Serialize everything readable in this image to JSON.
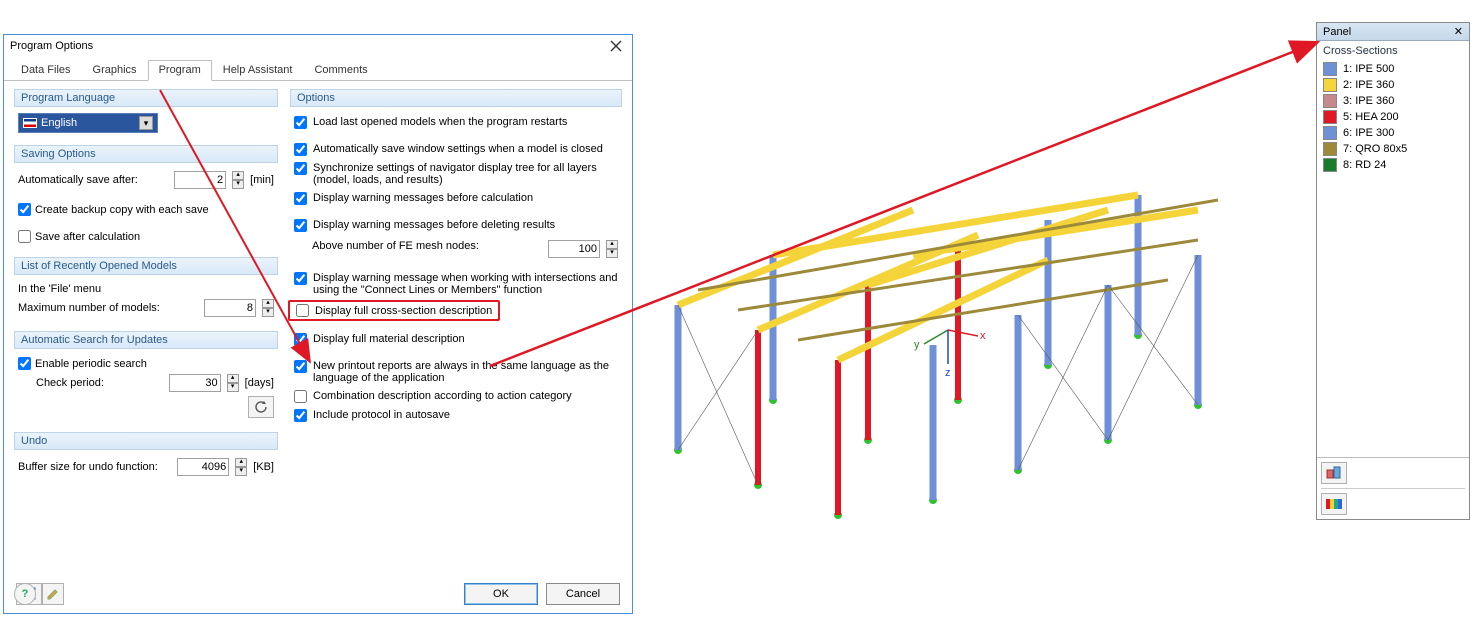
{
  "dialog": {
    "title": "Program Options",
    "tabs": [
      "Data Files",
      "Graphics",
      "Program",
      "Help Assistant",
      "Comments"
    ],
    "active_tab": 2,
    "groups": {
      "lang": {
        "header": "Program Language",
        "value": "English"
      },
      "saving": {
        "header": "Saving Options",
        "auto_save_label": "Automatically save after:",
        "auto_save_value": "2",
        "auto_save_unit": "[min]",
        "backup_label": "Create backup copy with each save",
        "backup_checked": true,
        "save_after_calc_label": "Save after calculation",
        "save_after_calc_checked": false
      },
      "recent": {
        "header": "List of Recently Opened Models",
        "menu_label": "In the 'File' menu",
        "max_label": "Maximum number of models:",
        "max_value": "8"
      },
      "updates": {
        "header": "Automatic Search for Updates",
        "enable_label": "Enable periodic search",
        "enable_checked": true,
        "period_label": "Check period:",
        "period_value": "30",
        "period_unit": "[days]"
      },
      "undo": {
        "header": "Undo",
        "buffer_label": "Buffer size for undo function:",
        "buffer_value": "4096",
        "buffer_unit": "[KB]"
      },
      "options": {
        "header": "Options",
        "items": [
          {
            "label": "Load last opened models when the program restarts",
            "checked": true
          },
          {
            "label": "Automatically save window settings when a model is closed",
            "checked": true
          },
          {
            "label": "Synchronize settings of navigator display tree for all layers (model, loads, and results)",
            "checked": true
          },
          {
            "label": "Display warning messages before calculation",
            "checked": true
          },
          {
            "label": "Display warning messages before deleting results",
            "checked": true
          },
          {
            "label_prefix": "Above number of FE mesh nodes:",
            "value": "100",
            "is_num": true
          },
          {
            "label": "Display warning message when working with intersections and using the \"Connect Lines or Members\" function",
            "checked": true
          },
          {
            "label": "Display full cross-section description",
            "checked": false,
            "highlight": true
          },
          {
            "label": "Display full material description",
            "checked": true
          },
          {
            "label": "New printout reports are always in the same language as the language of the application",
            "checked": true
          },
          {
            "label": "Combination description according to action category",
            "checked": false
          },
          {
            "label": "Include protocol in autosave",
            "checked": true
          }
        ]
      }
    },
    "footer": {
      "ok": "OK",
      "cancel": "Cancel"
    }
  },
  "panel": {
    "title": "Panel",
    "section": "Cross-Sections",
    "items": [
      {
        "label": "1: IPE 500",
        "color": "#6f8fd6"
      },
      {
        "label": "2: IPE 360",
        "color": "#f5d43a"
      },
      {
        "label": "3: IPE 360",
        "color": "#c68a8c"
      },
      {
        "label": "5: HEA 200",
        "color": "#e01825"
      },
      {
        "label": "6: IPE 300",
        "color": "#6f8fd6"
      },
      {
        "label": "7: QRO 80x5",
        "color": "#9c8a3a"
      },
      {
        "label": "8: RD 24",
        "color": "#1a7a2e"
      }
    ]
  }
}
